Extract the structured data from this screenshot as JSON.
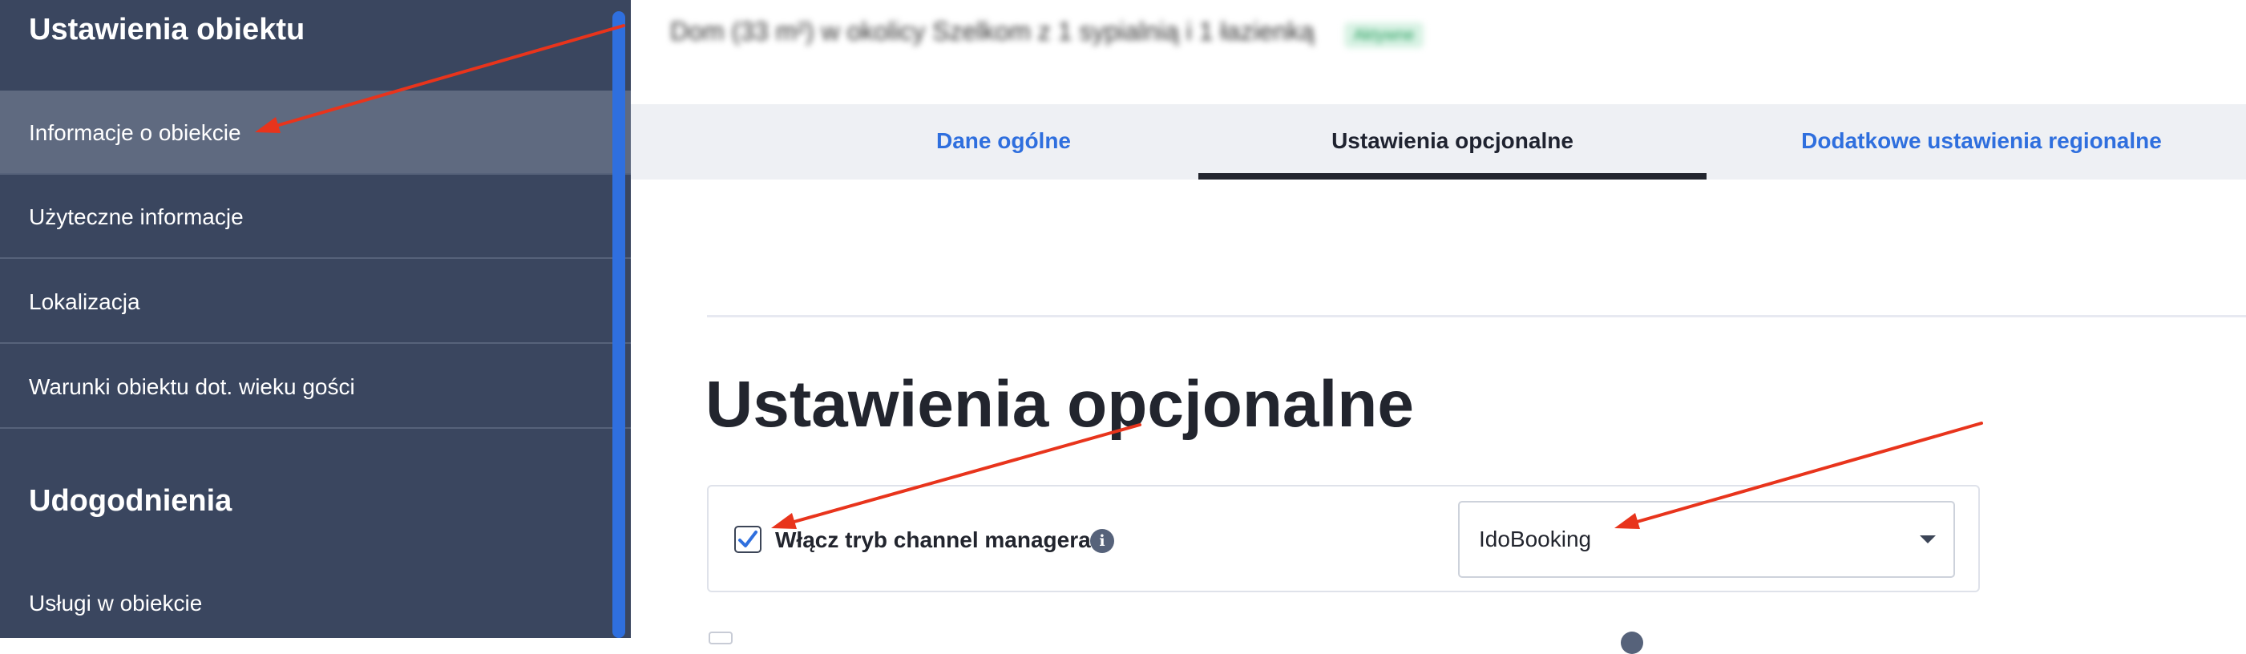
{
  "sidebar": {
    "section1_title": "Ustawienia obiektu",
    "section1_items": [
      {
        "label": "Informacje o obiekcie",
        "active": true
      },
      {
        "label": "Użyteczne informacje",
        "active": false
      },
      {
        "label": "Lokalizacja",
        "active": false
      },
      {
        "label": "Warunki obiektu dot. wieku gości",
        "active": false
      }
    ],
    "section2_title": "Udogodnienia",
    "section2_items": [
      {
        "label": "Usługi w obiekcie",
        "active": false
      }
    ]
  },
  "header": {
    "blurred_title": "Dom (33 m²) w okolicy Szelkom z 1 sypialnią i 1 łazienką",
    "blurred_badge": "Aktywne"
  },
  "tabs": [
    {
      "label": "Dane ogólne",
      "active": false
    },
    {
      "label": "Ustawienia opcjonalne",
      "active": true
    },
    {
      "label": "Dodatkowe ustawienia regionalne",
      "active": false
    }
  ],
  "main": {
    "section_title": "Ustawienia opcjonalne",
    "channel_manager": {
      "checkbox_label": "Włącz tryb channel managera",
      "checked": true,
      "info_glyph": "i",
      "select_value": "IdoBooking"
    }
  },
  "colors": {
    "sidebar_bg": "#3a465f",
    "sidebar_active": "#5f6a80",
    "accent_blue": "#2f6fde",
    "annotation_red": "#e8341c"
  },
  "icons": [
    "info-icon",
    "checkmark-icon",
    "chevron-down-icon"
  ]
}
